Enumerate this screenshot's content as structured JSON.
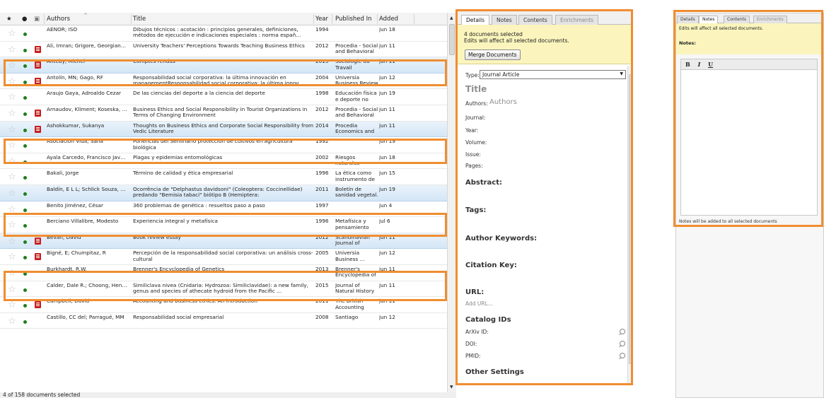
{
  "list": {
    "columns": {
      "star": "★",
      "read": "●",
      "file": "▣",
      "authors": "Authors",
      "title": "Title",
      "year": "Year",
      "published_in": "Published In",
      "added": "Added"
    },
    "rows": [
      {
        "authors": "AENOR; ISO",
        "title": "Dibujos técnicos : acotación : principios generales, definiciones, métodos de ejecución e indicaciones especiales : norma españ…",
        "year": "1994",
        "published_in": "",
        "added": "jun 18",
        "pdf": false,
        "selected": false
      },
      {
        "authors": "Ali, Imran; Grigore, Georgian…",
        "title": "University Teachers' Perceptions Towards Teaching Business Ethics",
        "year": "2012",
        "published_in": "Procedia - Social and Behavioral Sci…",
        "added": "jun 11",
        "pdf": true,
        "selected": false
      },
      {
        "authors": "Anteby, Michel",
        "title": "Comptes rendus",
        "year": "2015",
        "published_in": "Sociologie du Travail",
        "added": "jun 11",
        "pdf": true,
        "selected": true
      },
      {
        "authors": "Antolín, MN; Gago, RF",
        "title": "Responsabilidad social corporativa: la última innovación en managementResponsabilidad social corporativa: la última innov…",
        "year": "2004",
        "published_in": "Universia Business Review",
        "added": "jun 12",
        "pdf": true,
        "selected": false
      },
      {
        "authors": "Araujo Gaya, Adroaldo Cezar",
        "title": "De las ciencias del deporte a la ciencia del deporte",
        "year": "1998",
        "published_in": "Educación física e deporte no século …",
        "added": "jun 19",
        "pdf": false,
        "selected": false
      },
      {
        "authors": "Arnaudov, Kliment; Koseska, …",
        "title": "Business Ethics and Social Responsibility in Tourist Organizations in Terms of Changing Environment",
        "year": "2012",
        "published_in": "Procedia - Social and Behavioral Sci…",
        "added": "jun 11",
        "pdf": true,
        "selected": false
      },
      {
        "authors": "Ashokkumar, Sukanya",
        "title": "Thoughts on Business Ethics and Corporate Social Responsibility from Vedic Literature",
        "year": "2014",
        "published_in": "Procedia Economics and Finance",
        "added": "jun 11",
        "pdf": true,
        "selected": true
      },
      {
        "authors": "Asociación Vida, Sana",
        "title": "Ponencias del Seminario protección de cultivos en agricultura biológica",
        "year": "1992",
        "published_in": "",
        "added": "jun 19",
        "pdf": false,
        "selected": false
      },
      {
        "authors": "Ayala Carcedo, Francisco Jav…",
        "title": "Plagas y epidemias entomológicas",
        "year": "2002",
        "published_in": "Riesgos naturales",
        "added": "jun 18",
        "pdf": false,
        "selected": false
      },
      {
        "authors": "Bakali, Jorge",
        "title": "Término de calidad y ética empresarial",
        "year": "1996",
        "published_in": "La ética como instrumento de gest…",
        "added": "jun 15",
        "pdf": false,
        "selected": false
      },
      {
        "authors": "Baldín, E L L; Schlick Souza, …",
        "title": "Ocorrência de \"Delphastus davidsoni\" (Coleoptera: Coccinellidae) predando \"Bemisia tabaci\" biótipo B (Hemiptera:",
        "year": "2011",
        "published_in": "Boletín de sanidad vegetal. Plagas",
        "added": "jun 19",
        "pdf": false,
        "selected": true
      },
      {
        "authors": "Benito Jiménez, César",
        "title": "360 problemas de genética : resueltos paso a paso",
        "year": "1997",
        "published_in": "",
        "added": "jun 4",
        "pdf": false,
        "selected": false
      },
      {
        "authors": "Berciano Villalibre, Modesto",
        "title": "Experiencia integral y metafísica",
        "year": "1996",
        "published_in": "Metafísica y pensamiento actu…",
        "added": "jul 6",
        "pdf": false,
        "selected": false
      },
      {
        "authors": "Bevan, David",
        "title": "Book review essay",
        "year": "2012",
        "published_in": "Scandinavian Journal of Manage…",
        "added": "jun 11",
        "pdf": true,
        "selected": true
      },
      {
        "authors": "Bigné, E; Chumpitaz, R",
        "title": "Percepción de la responsabilidad social corporativa: un análisis cross-cultural",
        "year": "2005",
        "published_in": "Universia Business …",
        "added": "jun 12",
        "pdf": true,
        "selected": false
      },
      {
        "authors": "Burkhardt, R.W.",
        "title": "Brenner's Encyclopedia of Genetics",
        "year": "2013",
        "published_in": "Brenner's Encyclopedia of G…",
        "added": "jun 11",
        "pdf": false,
        "selected": false
      },
      {
        "authors": "Calder, Dale R.; Choong, Hen…",
        "title": "Similiclava nivea (Cnidaria: Hydrozoa: Similiclavidae): a new family, genus and species of athecate hydroid from the Pacific …",
        "year": "2015",
        "published_in": "Journal of Natural History",
        "added": "jun 11",
        "pdf": false,
        "selected": false
      },
      {
        "authors": "Campbell, David",
        "title": "Accounting and business ethics: An introduction",
        "year": "2011",
        "published_in": "The British Accounting Review",
        "added": "jun 11",
        "pdf": true,
        "selected": false
      },
      {
        "authors": "Castillo, CC del; Parragué, MM",
        "title": "Responsabilidad social empresarial",
        "year": "2008",
        "published_in": "Santiago",
        "added": "jun 12",
        "pdf": false,
        "selected": false
      }
    ]
  },
  "status": {
    "text": "4 of 158 documents selected"
  },
  "details": {
    "tabs": [
      "Details",
      "Notes",
      "Contents",
      "Enrichments"
    ],
    "banner_line1": "4 documents selected",
    "banner_line2": "Edits will affect all selected documents.",
    "merge_button": "Merge Documents",
    "type_label": "Type:",
    "type_value": "Journal Article",
    "title_placeholder": "Title",
    "authors_label": "Authors:",
    "authors_placeholder": "Authors",
    "journal_label": "Journal:",
    "year_label": "Year:",
    "volume_label": "Volume:",
    "issue_label": "Issue:",
    "pages_label": "Pages:",
    "abstract_label": "Abstract:",
    "tags_label": "Tags:",
    "author_keywords_label": "Author Keywords:",
    "citation_key_label": "Citation Key:",
    "url_label": "URL:",
    "add_url": "Add URL...",
    "catalog_ids_label": "Catalog IDs",
    "arxiv_label": "ArXiv ID:",
    "doi_label": "DOI:",
    "pmid_label": "PMID:",
    "other_settings_label": "Other Settings"
  },
  "notes": {
    "tabs": [
      "Details",
      "Notes",
      "Contents",
      "Enrichments"
    ],
    "banner": "Edits will affect all selected documents.",
    "notes_label": "Notes:",
    "bold": "B",
    "italic": "I",
    "underline": "U",
    "footer": "Notes will be added to all selected documents"
  },
  "colors": {
    "highlight": "#f08d30",
    "selection": "#d4e6f6",
    "banner": "#fbf5bd",
    "read_dot": "#1c7f1c",
    "pdf_icon": "#c51f1f"
  }
}
